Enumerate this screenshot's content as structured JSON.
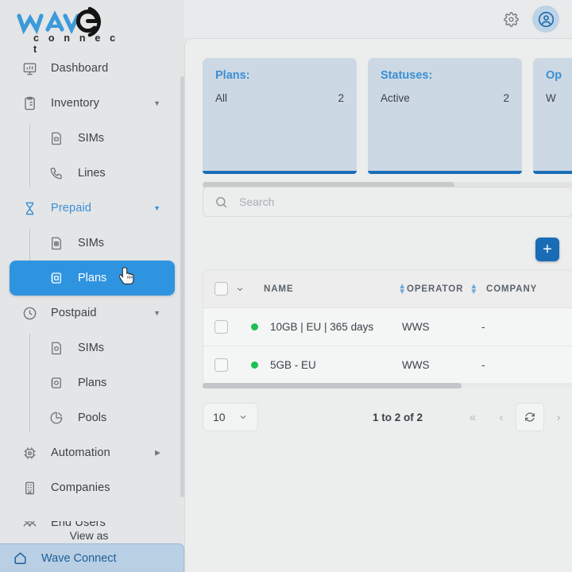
{
  "brand": {
    "name": "wave",
    "subtitle": "c o n n e c t",
    "accent_blue": "#3b8fd4",
    "dark": "#1a1a1a"
  },
  "topbar": {
    "settings_icon": "gear-icon",
    "account_icon": "user-circle-icon"
  },
  "sidebar": {
    "items": [
      {
        "label": "Dashboard",
        "icon": "dashboard-icon"
      },
      {
        "label": "Inventory",
        "icon": "clipboard-icon",
        "caret": "▼"
      },
      {
        "label": "SIMs",
        "icon": "sim-card-icon"
      },
      {
        "label": "Lines",
        "icon": "phone-icon"
      },
      {
        "label": "Prepaid",
        "icon": "hourglass-icon",
        "caret": "▼"
      },
      {
        "label": "SIMs",
        "icon": "sim-card-icon"
      },
      {
        "label": "Plans",
        "icon": "plan-card-icon"
      },
      {
        "label": "Postpaid",
        "icon": "clock-icon",
        "caret": "▼"
      },
      {
        "label": "SIMs",
        "icon": "sim-card-icon"
      },
      {
        "label": "Plans",
        "icon": "plan-card-icon"
      },
      {
        "label": "Pools",
        "icon": "pie-chart-icon"
      },
      {
        "label": "Automation",
        "icon": "chip-icon",
        "caret": "▶"
      },
      {
        "label": "Companies",
        "icon": "building-icon"
      },
      {
        "label": "End Users",
        "icon": "users-icon"
      }
    ],
    "view_as_label": "View as",
    "organization": {
      "label": "Wave Connect",
      "icon": "home-icon"
    }
  },
  "cards": [
    {
      "title": "Plans:",
      "rows": [
        {
          "label": "All",
          "value": "2"
        }
      ]
    },
    {
      "title": "Statuses:",
      "rows": [
        {
          "label": "Active",
          "value": "2"
        }
      ]
    },
    {
      "title": "Op",
      "rows": [
        {
          "label": "W",
          "value": ""
        }
      ]
    }
  ],
  "search": {
    "placeholder": "Search",
    "value": "",
    "icon": "search-icon"
  },
  "add_button": {
    "label": "+",
    "icon": "plus-icon"
  },
  "table": {
    "columns": [
      {
        "key": "name",
        "label": "NAME",
        "sortable": true
      },
      {
        "key": "operator",
        "label": "OPERATOR",
        "sortable": true
      },
      {
        "key": "company",
        "label": "COMPANY",
        "sortable": false
      }
    ],
    "rows": [
      {
        "status": "active",
        "name": "10GB | EU | 365 days",
        "operator": "WWS",
        "company": "-"
      },
      {
        "status": "active",
        "name": "5GB - EU",
        "operator": "WWS",
        "company": "-"
      }
    ],
    "status_color": "#1ebf55"
  },
  "pagination": {
    "page_size": "10",
    "range_text": "1 to 2 of 2",
    "first_label": "«",
    "prev_label": "‹",
    "refresh_label": "refresh-icon",
    "next_label": "›"
  }
}
